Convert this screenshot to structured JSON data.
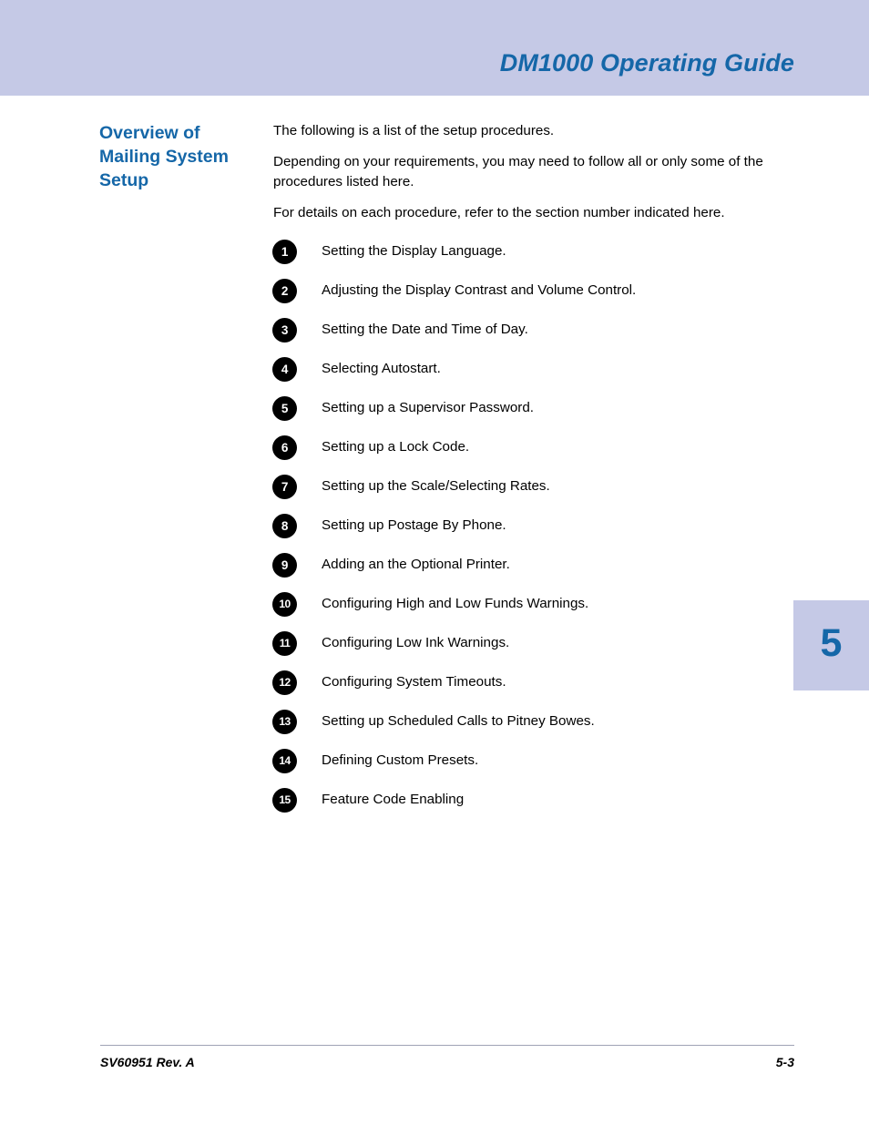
{
  "header": {
    "title": "DM1000 Operating Guide",
    "banner_color": "#c5c9e6",
    "title_color": "#1567a8"
  },
  "section": {
    "heading": "Overview of Mailing System Setup",
    "paragraphs": [
      "The following is a list of the setup procedures.",
      "Depending on your requirements, you may need to follow all or only some of the procedures listed here.",
      "For details on each procedure, refer to the section number indicated here."
    ]
  },
  "procedures": [
    {
      "number": "1",
      "text": "Setting the Display Language."
    },
    {
      "number": "2",
      "text": "Adjusting the Display Contrast and Volume Control."
    },
    {
      "number": "3",
      "text": "Setting the Date and Time of Day."
    },
    {
      "number": "4",
      "text": "Selecting Autostart."
    },
    {
      "number": "5",
      "text": "Setting up a Supervisor Password."
    },
    {
      "number": "6",
      "text": "Setting up a Lock Code."
    },
    {
      "number": "7",
      "text": "Setting up the Scale/Selecting Rates."
    },
    {
      "number": "8",
      "text": "Setting up Postage By Phone."
    },
    {
      "number": "9",
      "text": "Adding an the Optional Printer."
    },
    {
      "number": "10",
      "text": "Configuring High and Low Funds Warnings."
    },
    {
      "number": "11",
      "text": "Configuring Low Ink Warnings."
    },
    {
      "number": "12",
      "text": "Configuring System Timeouts."
    },
    {
      "number": "13",
      "text": "Setting up Scheduled Calls to Pitney Bowes."
    },
    {
      "number": "14",
      "text": "Defining Custom Presets."
    },
    {
      "number": "15",
      "text": "Feature Code Enabling"
    }
  ],
  "chapter_tab": {
    "number": "5",
    "background_color": "#c5c9e6",
    "number_color": "#1567a8"
  },
  "footer": {
    "document_id": "SV60951 Rev. A",
    "page_number": "5-3"
  }
}
